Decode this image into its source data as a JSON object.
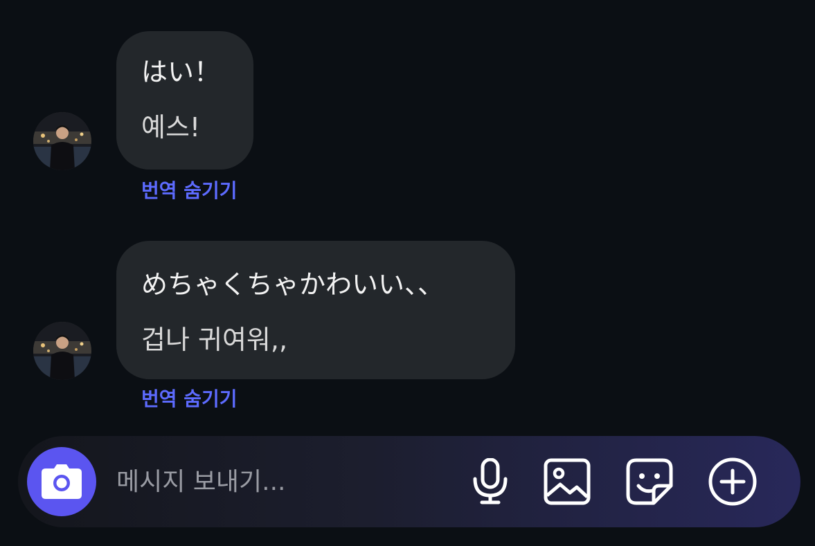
{
  "messages": [
    {
      "original": "はい！",
      "translation": "예스!",
      "hide_translation_label": "번역 숨기기"
    },
    {
      "original": "めちゃくちゃかわいい、、",
      "translation": "겁나 귀여워,,",
      "hide_translation_label": "번역 숨기기"
    }
  ],
  "composer": {
    "placeholder": "메시지 보내기..."
  },
  "icons": {
    "camera": "camera-icon",
    "microphone": "microphone-icon",
    "gallery": "image-icon",
    "sticker": "sticker-icon",
    "more": "plus-circle-icon"
  },
  "colors": {
    "background": "#0b0f14",
    "bubble": "#23272b",
    "link": "#5d6bff",
    "camera_button": "#5b55f0"
  }
}
